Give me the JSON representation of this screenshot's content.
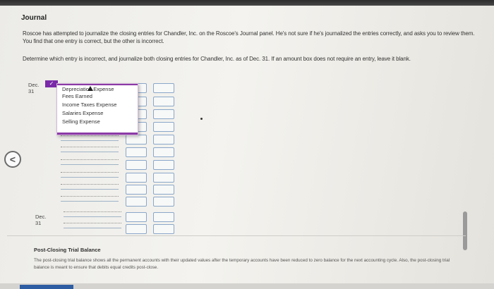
{
  "page": {
    "heading": "Journal",
    "paragraph1": "Roscoe has attempted to journalize the closing entries for Chandler, Inc. on the Roscoe's Journal panel. He's not sure if he's journalized the entries correctly, and asks you to review them. You find that one entry is correct, but the other is incorrect.",
    "paragraph2": "Determine which entry is incorrect, and journalize both closing entries for Chandler, Inc. as of Dec. 31. If an amount box does not require an entry, leave it blank."
  },
  "journal": {
    "date1": "Dec. 31",
    "date2": "Dec. 31",
    "dropdown_options": [
      "Depreciation Expense",
      "Fees Earned",
      "Income Taxes Expense",
      "Salaries Expense",
      "Selling Expense"
    ],
    "selected_marker": "✓"
  },
  "post_closing": {
    "title": "Post-Closing Trial Balance",
    "text": "The post-closing trial balance shows all the permanent accounts with their updated values after the temporary accounts have been reduced to zero balance for the next accounting cycle. Also, the post-closing trial balance is meant to ensure that debits equal credits post-close."
  },
  "nav": {
    "back_glyph": "<"
  }
}
